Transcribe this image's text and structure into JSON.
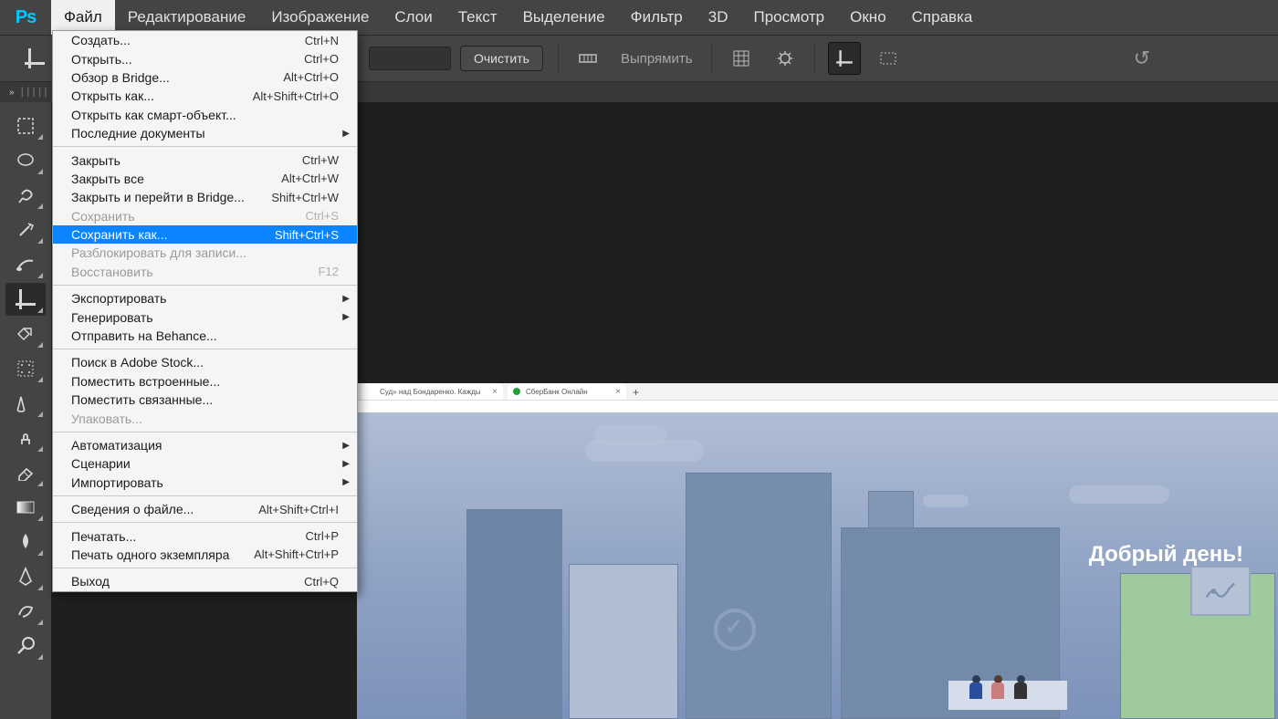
{
  "menubar": {
    "items": [
      "Файл",
      "Редактирование",
      "Изображение",
      "Слои",
      "Текст",
      "Выделение",
      "Фильтр",
      "3D",
      "Просмотр",
      "Окно",
      "Справка"
    ],
    "open_index": 0
  },
  "options": {
    "clear_label": "Очистить",
    "straighten_label": "Выпрямить"
  },
  "dropdown": [
    {
      "label": "Создать...",
      "shortcut": "Ctrl+N"
    },
    {
      "label": "Открыть...",
      "shortcut": "Ctrl+O"
    },
    {
      "label": "Обзор в Bridge...",
      "shortcut": "Alt+Ctrl+O"
    },
    {
      "label": "Открыть как...",
      "shortcut": "Alt+Shift+Ctrl+O"
    },
    {
      "label": "Открыть как смарт-объект..."
    },
    {
      "label": "Последние документы",
      "submenu": true
    },
    {
      "sep": true
    },
    {
      "label": "Закрыть",
      "shortcut": "Ctrl+W"
    },
    {
      "label": "Закрыть все",
      "shortcut": "Alt+Ctrl+W"
    },
    {
      "label": "Закрыть и перейти в Bridge...",
      "shortcut": "Shift+Ctrl+W"
    },
    {
      "label": "Сохранить",
      "shortcut": "Ctrl+S",
      "disabled": true
    },
    {
      "label": "Сохранить как...",
      "shortcut": "Shift+Ctrl+S",
      "highlight": true
    },
    {
      "label": "Разблокировать для записи...",
      "disabled": true
    },
    {
      "label": "Восстановить",
      "shortcut": "F12",
      "disabled": true
    },
    {
      "sep": true
    },
    {
      "label": "Экспортировать",
      "submenu": true
    },
    {
      "label": "Генерировать",
      "submenu": true
    },
    {
      "label": "Отправить на Behance..."
    },
    {
      "sep": true
    },
    {
      "label": "Поиск в Adobe Stock..."
    },
    {
      "label": "Поместить встроенные..."
    },
    {
      "label": "Поместить связанные..."
    },
    {
      "label": "Упаковать...",
      "disabled": true
    },
    {
      "sep": true
    },
    {
      "label": "Автоматизация",
      "submenu": true
    },
    {
      "label": "Сценарии",
      "submenu": true
    },
    {
      "label": "Импортировать",
      "submenu": true
    },
    {
      "sep": true
    },
    {
      "label": "Сведения о файле...",
      "shortcut": "Alt+Shift+Ctrl+I"
    },
    {
      "sep": true
    },
    {
      "label": "Печатать...",
      "shortcut": "Ctrl+P"
    },
    {
      "label": "Печать одного экземпляра",
      "shortcut": "Alt+Shift+Ctrl+P"
    },
    {
      "sep": true
    },
    {
      "label": "Выход",
      "shortcut": "Ctrl+Q"
    }
  ],
  "browser_tabs": [
    {
      "title": "Суд» над Бондаренко. Кажды",
      "favicon": "#cc3333"
    },
    {
      "title": "СберБанк Онлайн",
      "favicon": "#21a038"
    }
  ],
  "document": {
    "greeting": "Добрый день!"
  },
  "tools": [
    "move",
    "marquee",
    "lasso",
    "magic-wand",
    "quick-select",
    "crop",
    "slice",
    "frame",
    "eyedropper",
    "brush",
    "clone",
    "eraser",
    "gradient",
    "blur",
    "pen",
    "smudge",
    "zoom"
  ]
}
